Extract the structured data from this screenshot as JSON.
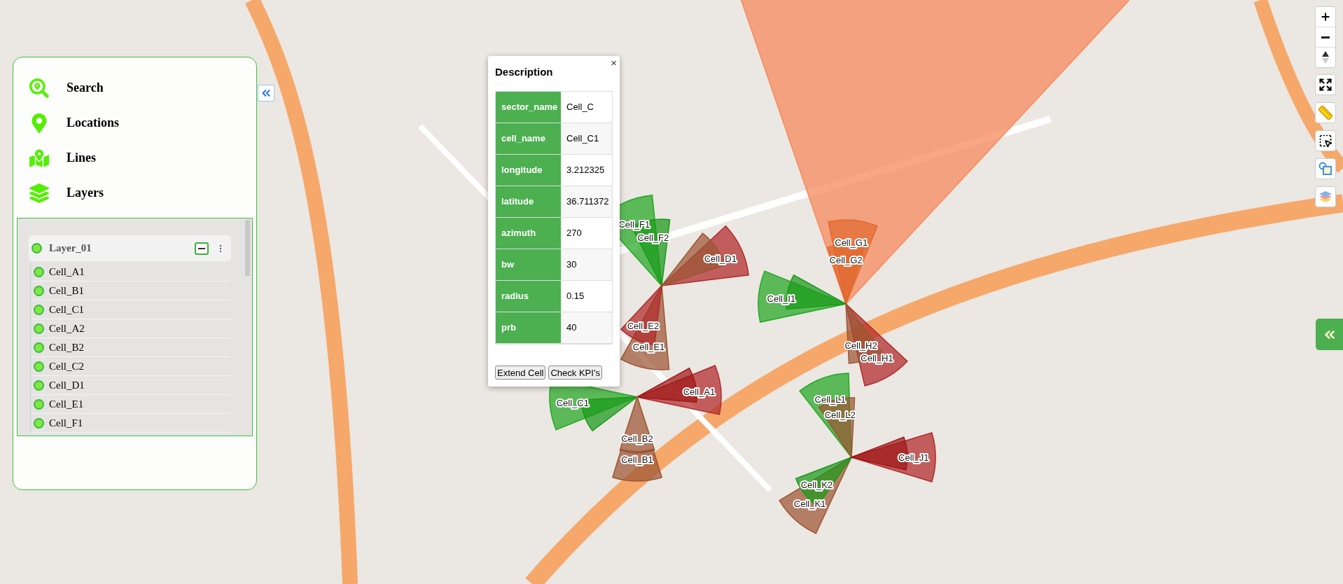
{
  "sidebar": {
    "menu": [
      {
        "kind": "search",
        "label": "Search"
      },
      {
        "kind": "locations",
        "label": "Locations"
      },
      {
        "kind": "lines",
        "label": "Lines"
      },
      {
        "kind": "layers",
        "label": "Layers"
      }
    ],
    "layer": {
      "name": "Layer_01",
      "visible": true,
      "expanded": true,
      "cells": [
        {
          "name": "Cell_A1",
          "visible": true
        },
        {
          "name": "Cell_B1",
          "visible": true
        },
        {
          "name": "Cell_C1",
          "visible": true
        },
        {
          "name": "Cell_A2",
          "visible": true
        },
        {
          "name": "Cell_B2",
          "visible": true
        },
        {
          "name": "Cell_C2",
          "visible": true
        },
        {
          "name": "Cell_D1",
          "visible": true
        },
        {
          "name": "Cell_E1",
          "visible": true
        },
        {
          "name": "Cell_F1",
          "visible": true
        }
      ]
    }
  },
  "popup": {
    "title": "Description",
    "close": "×",
    "rows": [
      {
        "key": "sector_name",
        "value": "Cell_C"
      },
      {
        "key": "cell_name",
        "value": "Cell_C1"
      },
      {
        "key": "longitude",
        "value": "3.212325"
      },
      {
        "key": "latitude",
        "value": "36.711372"
      },
      {
        "key": "azimuth",
        "value": "270"
      },
      {
        "key": "bw",
        "value": "30"
      },
      {
        "key": "radius",
        "value": "0.15"
      },
      {
        "key": "prb",
        "value": "40"
      }
    ],
    "buttons": [
      "Extend Cell",
      "Check KPI's"
    ]
  },
  "sites": [
    {
      "sectors": [
        {
          "label": "Cell_F1",
          "color": "#22a822"
        },
        {
          "label": "Cell_F2",
          "color": "#1a9a1a"
        },
        {
          "label": "Cell_D1",
          "color": "#b02a2a"
        },
        {
          "color": "#9c5634"
        },
        {
          "label": "Cell_E2",
          "color": "#b02a2a"
        },
        {
          "label": "Cell_E1",
          "color": "#9c5634"
        }
      ]
    },
    {
      "sectors": [
        {
          "label": "Cell_C1",
          "color": "#22a822"
        },
        {
          "color": "#1a9a1a"
        },
        {
          "label": "Cell_A1",
          "color": "#b02a2a"
        },
        {
          "color": "#a01818"
        },
        {
          "label": "Cell_B2",
          "color": "#9c5634"
        },
        {
          "label": "Cell_B1",
          "color": "#9c5634"
        }
      ]
    },
    {
      "sectors": [
        {
          "color": "#f58a5c"
        },
        {
          "label": "Cell_G1",
          "color": "#e06a2f"
        },
        {
          "label": "Cell_G2",
          "color": "#e06a2f"
        },
        {
          "label": "Cell_I1",
          "color": "#22a822"
        },
        {
          "color": "#1a9a1a"
        },
        {
          "label": "Cell_H2",
          "color": "#9c5634"
        },
        {
          "label": "Cell_H1",
          "color": "#b02a2a"
        }
      ]
    },
    {
      "sectors": [
        {
          "label": "Cell_L1",
          "color": "#22a822"
        },
        {
          "label": "Cell_L2",
          "color": "#9c5634"
        },
        {
          "label": "Cell_J1",
          "color": "#b02a2a"
        },
        {
          "color": "#a01818"
        },
        {
          "label": "Cell_K2",
          "color": "#1a9a1a"
        },
        {
          "label": "Cell_K1",
          "color": "#9c5634"
        }
      ]
    }
  ]
}
